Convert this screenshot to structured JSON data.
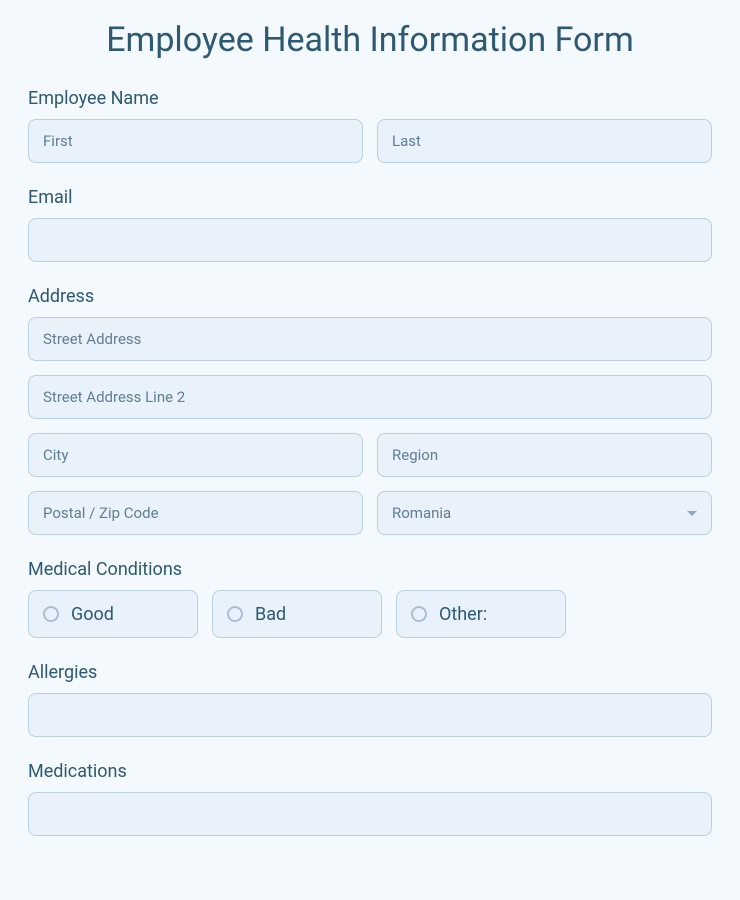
{
  "title": "Employee Health Information Form",
  "employeeName": {
    "label": "Employee Name",
    "firstPlaceholder": "First",
    "lastPlaceholder": "Last"
  },
  "email": {
    "label": "Email"
  },
  "address": {
    "label": "Address",
    "streetPlaceholder": "Street Address",
    "street2Placeholder": "Street Address Line 2",
    "cityPlaceholder": "City",
    "regionPlaceholder": "Region",
    "postalPlaceholder": "Postal / Zip Code",
    "countrySelected": "Romania"
  },
  "medicalConditions": {
    "label": "Medical Conditions",
    "options": {
      "good": "Good",
      "bad": "Bad",
      "other": "Other:"
    }
  },
  "allergies": {
    "label": "Allergies"
  },
  "medications": {
    "label": "Medications"
  }
}
